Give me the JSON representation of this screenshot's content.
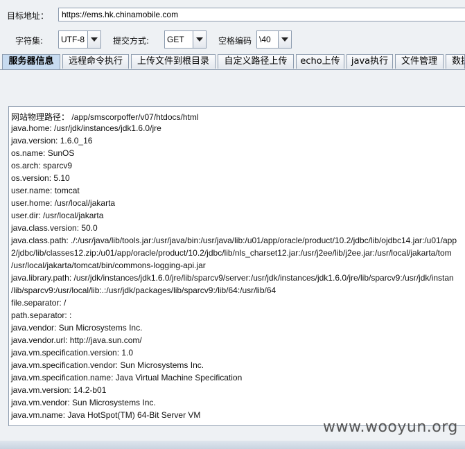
{
  "form": {
    "target_label": "目标地址：",
    "target_url": "https://ems.hk.chinamobile.com",
    "charset_label": "字符集:",
    "charset_value": "UTF-8",
    "method_label": "提交方式:",
    "method_value": "GET",
    "space_label": "空格编码",
    "space_value": "\\40"
  },
  "tabs": [
    {
      "label": "服务器信息",
      "active": true
    },
    {
      "label": "远程命令执行"
    },
    {
      "label": "上传文件到根目录"
    },
    {
      "label": "自定义路径上传"
    },
    {
      "label": "echo上传"
    },
    {
      "label": "java执行"
    },
    {
      "label": "文件管理"
    },
    {
      "label": "数据"
    }
  ],
  "output_lines": [
    "网站物理路径：  /app/smscorpoffer/v07/htdocs/html",
    "java.home: /usr/jdk/instances/jdk1.6.0/jre",
    "java.version: 1.6.0_16",
    "os.name: SunOS",
    "os.arch: sparcv9",
    "os.version: 5.10",
    "user.name: tomcat",
    "user.home: /usr/local/jakarta",
    "user.dir: /usr/local/jakarta",
    "java.class.version: 50.0",
    "java.class.path: ./:/usr/java/lib/tools.jar:/usr/java/bin:/usr/java/lib:/u01/app/oracle/product/10.2/jdbc/lib/ojdbc14.jar:/u01/app",
    "2/jdbc/lib/classes12.zip:/u01/app/oracle/product/10.2/jdbc/lib/nls_charset12.jar:/usr/j2ee/lib/j2ee.jar:/usr/local/jakarta/tom",
    "/usr/local/jakarta/tomcat/bin/commons-logging-api.jar",
    "java.library.path: /usr/jdk/instances/jdk1.6.0/jre/lib/sparcv9/server:/usr/jdk/instances/jdk1.6.0/jre/lib/sparcv9:/usr/jdk/instan",
    "/lib/sparcv9:/usr/local/lib:.:/usr/jdk/packages/lib/sparcv9:/lib/64:/usr/lib/64",
    "file.separator: /",
    "path.separator: :",
    "java.vendor: Sun Microsystems Inc.",
    "java.vendor.url: http://java.sun.com/",
    "java.vm.specification.version: 1.0",
    "java.vm.specification.vendor: Sun Microsystems Inc.",
    "java.vm.specification.name: Java Virtual Machine Specification",
    "java.vm.version: 14.2-b01",
    "java.vm.vendor: Sun Microsystems Inc.",
    "java.vm.name: Java HotSpot(TM) 64-Bit Server VM"
  ],
  "watermark": "www.wooyun.org",
  "colors": {
    "active_tab": "#c7dbf0",
    "border": "#8c9bae",
    "background": "#eef1f4"
  }
}
